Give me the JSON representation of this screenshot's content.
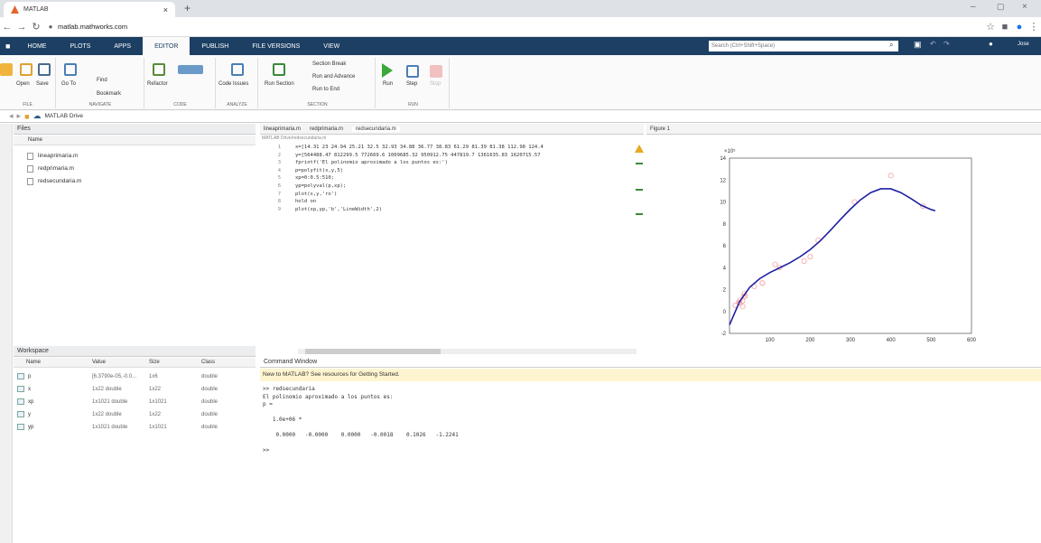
{
  "browser": {
    "tab_title": "MATLAB",
    "url": "matlab.mathworks.com"
  },
  "toolstrip": {
    "tabs": [
      "HOME",
      "PLOTS",
      "APPS",
      "EDITOR",
      "PUBLISH",
      "FILE VERSIONS",
      "VIEW"
    ],
    "active_tab": "EDITOR",
    "search_placeholder": "Search (Ctrl+Shift+Space)",
    "file_group": {
      "buttons": [
        "New",
        "Open",
        "Save"
      ],
      "label": "FILE"
    },
    "navigate_group": {
      "go_to": "Go To",
      "find": "Find",
      "bookmark": "Bookmark",
      "label": "NAVIGATE"
    },
    "code_group": {
      "refactor": "Refactor",
      "label": "CODE"
    },
    "analyze_group": {
      "code_issues": "Code Issues",
      "label": "ANALYZE"
    },
    "section_group": {
      "run_section": "Run Section",
      "section_break": "Section Break",
      "run_and_advance": "Run and Advance",
      "run_to_end": "Run to End",
      "label": "SECTION"
    },
    "run_group": {
      "run": "Run",
      "step": "Step",
      "stop": "Stop",
      "label": "RUN"
    },
    "user": "Jose"
  },
  "path": "MATLAB Drive",
  "files_panel": {
    "title": "Files",
    "column": "Name",
    "files": [
      "lineaprimaria.m",
      "redprimaria.m",
      "redsecundaria.m"
    ]
  },
  "workspace": {
    "title": "Workspace",
    "columns": [
      "Name",
      "Value",
      "Size",
      "Class"
    ],
    "rows": [
      {
        "name": "p",
        "value": "[6.3790e-05,-0.0...",
        "size": "1x6",
        "class": "double"
      },
      {
        "name": "x",
        "value": "1x22 double",
        "size": "1x22",
        "class": "double"
      },
      {
        "name": "xp",
        "value": "1x1021 double",
        "size": "1x1021",
        "class": "double"
      },
      {
        "name": "y",
        "value": "1x22 double",
        "size": "1x22",
        "class": "double"
      },
      {
        "name": "yp",
        "value": "1x1021 double",
        "size": "1x1021",
        "class": "double"
      }
    ]
  },
  "editor": {
    "tabs": [
      "lineaprimaria.m",
      "redprimaria.m",
      "redsecundaria.m"
    ],
    "path": "MATLAB Drive/redsecundaria.m",
    "lines": [
      "x=[14.31 23 24.94 25.21 32.5 32.93 34.88 36.77 38.83 61.29 81.39 81.38 112.98 124.4",
      "y=[564488.47 812299.5 772669.6 1009685.32 950912.75 447819.7 1361635.83 1620715.57",
      "fprintf('El polinomio aproximado a los puntos es:')",
      "p=polyfit(x,y,5)",
      "xp=0:0.5:510;",
      "yp=polyval(p,xp);",
      "plot(x,y,'ro')",
      "hold on",
      "plot(xp,yp,'b','LineWidth',2)"
    ]
  },
  "command_window": {
    "title": "Command Window",
    "banner": "New to MATLAB? See resources for Getting Started.",
    "output": [
      ">> redsecundaria",
      "El polinomio aproximado a los puntos es:",
      "p =",
      "",
      "   1.0e+06 *",
      "",
      "    0.0000   -0.0000    0.0000   -0.0018    0.1026   -1.2241",
      "",
      ">>"
    ]
  },
  "figure": {
    "tab": "Figure 1",
    "colors": {
      "line": "#1f1fa3",
      "markers": "#f3a3a3"
    }
  },
  "chart_data": {
    "type": "scatter",
    "xlim": [
      0,
      600
    ],
    "ylim": [
      -2,
      14
    ],
    "yexponent": "×10⁵",
    "x_ticks": [
      100,
      200,
      300,
      400,
      500,
      600
    ],
    "y_ticks": [
      -2,
      0,
      2,
      4,
      6,
      8,
      10,
      12,
      14
    ],
    "grid": false,
    "series": [
      {
        "style": "markers",
        "x": [
          14.3,
          23,
          24.9,
          25.2,
          32.5,
          32.9,
          34.9,
          36.8,
          38.8,
          61.3,
          81.4,
          81.4,
          113,
          124.4,
          185,
          200,
          220,
          310,
          400,
          480
        ],
        "y": [
          0.56,
          0.81,
          0.77,
          1.01,
          0.95,
          0.45,
          1.36,
          1.62,
          1.4,
          2.3,
          2.6,
          2.6,
          4.3,
          4.0,
          4.6,
          5.0,
          6.5,
          10.0,
          12.4,
          9.6
        ]
      },
      {
        "style": "line",
        "x": [
          0,
          25,
          50,
          75,
          100,
          125,
          150,
          175,
          200,
          225,
          250,
          275,
          300,
          325,
          350,
          375,
          400,
          425,
          450,
          475,
          500,
          510
        ],
        "y": [
          -1.22,
          0.9,
          2.2,
          3.0,
          3.55,
          4.0,
          4.45,
          5.0,
          5.65,
          6.45,
          7.4,
          8.4,
          9.35,
          10.2,
          10.85,
          11.2,
          11.2,
          10.85,
          10.3,
          9.7,
          9.3,
          9.2
        ]
      }
    ]
  }
}
